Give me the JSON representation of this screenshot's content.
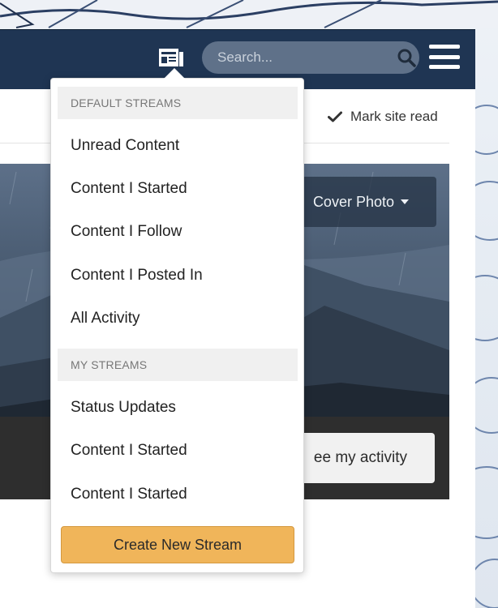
{
  "header": {
    "search_placeholder": "Search...",
    "stream_icon": "activity-stream-icon",
    "search_icon": "magnifier-icon",
    "menu_icon": "hamburger-icon",
    "bar_color": "#1f3553"
  },
  "page": {
    "mark_read_label": "Mark site read",
    "mark_read_icon": "checkmark-icon",
    "cover_photo_label": "Cover Photo",
    "activity_button_label": "ee my activity"
  },
  "stream_menu": {
    "default_heading": "DEFAULT STREAMS",
    "default_streams": [
      "Unread Content",
      "Content I Started",
      "Content I Follow",
      "Content I Posted In",
      "All Activity"
    ],
    "my_heading": "MY STREAMS",
    "my_streams": [
      "Status Updates",
      "Content I Started",
      "Content I Started"
    ],
    "create_button_label": "Create New Stream",
    "create_button_color": "#f0b55a"
  }
}
